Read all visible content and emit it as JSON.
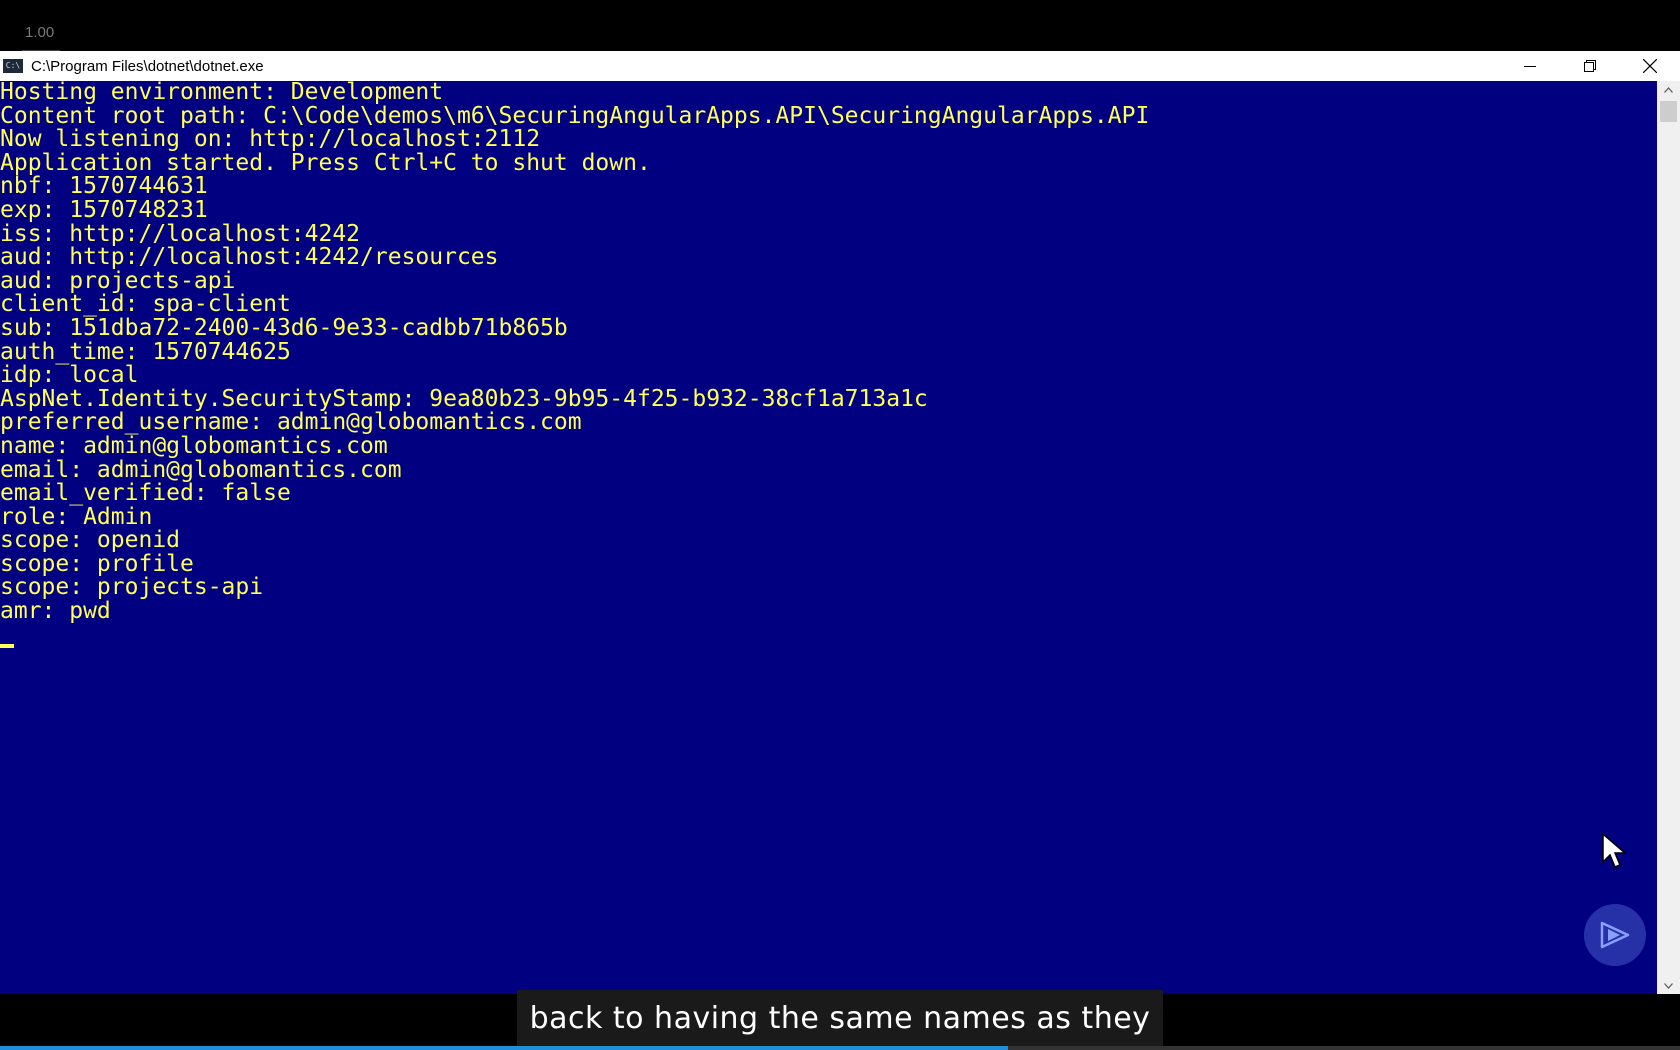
{
  "player": {
    "zoom_level": "1.00",
    "caption": "back to having the same names as they",
    "progress_fraction": 0.6
  },
  "window": {
    "title": "C:\\Program Files\\dotnet\\dotnet.exe",
    "icon": "console-app-icon",
    "controls": [
      "minimize-icon",
      "restore-icon",
      "close-icon"
    ]
  },
  "console": {
    "background": "#000080",
    "foreground": "#ffff55",
    "lines": [
      "Hosting environment: Development",
      "Content root path: C:\\Code\\demos\\m6\\SecuringAngularApps.API\\SecuringAngularApps.API",
      "Now listening on: http://localhost:2112",
      "Application started. Press Ctrl+C to shut down.",
      "nbf: 1570744631",
      "exp: 1570748231",
      "iss: http://localhost:4242",
      "aud: http://localhost:4242/resources",
      "aud: projects-api",
      "client_id: spa-client",
      "sub: 151dba72-2400-43d6-9e33-cadbb71b865b",
      "auth_time: 1570744625",
      "idp: local",
      "AspNet.Identity.SecurityStamp: 9ea80b23-9b95-4f25-b932-38cf1a713a1c",
      "preferred_username: admin@globomantics.com",
      "name: admin@globomantics.com",
      "email: admin@globomantics.com",
      "email_verified: false",
      "role: Admin",
      "scope: openid",
      "scope: profile",
      "scope: projects-api",
      "amr: pwd"
    ]
  }
}
